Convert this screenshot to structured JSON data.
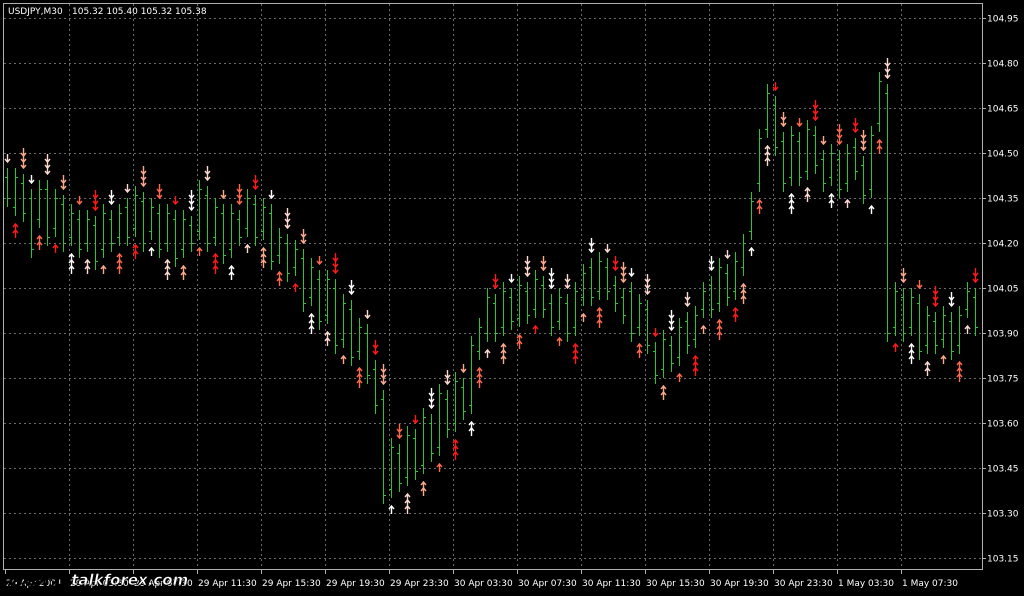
{
  "header": {
    "symbol": "USDJPY,M30",
    "ohlc": "105.32 105.40 105.32 105.38"
  },
  "colors": {
    "background": "#000000",
    "grid": "#6a6a6a",
    "frame": "#b0b0b0",
    "text": "#ffffff",
    "candle": "#2fc42f",
    "arrow_palette": [
      "#ff1a1a",
      "#ff6a4d",
      "#ffa98c",
      "#ffd8d0",
      "#ffffff"
    ]
  },
  "price_axis": {
    "labels": [
      "104.95",
      "104.80",
      "104.65",
      "104.50",
      "104.35",
      "104.20",
      "104.05",
      "103.90",
      "103.75",
      "103.60",
      "103.45",
      "103.30",
      "103.15"
    ],
    "min": 103.15,
    "max": 104.95
  },
  "time_axis": {
    "labels": [
      "29 Apr 2004",
      "29 Apr 03:30",
      "29 Apr 07:30",
      "29 Apr 11:30",
      "29 Apr 15:30",
      "29 Apr 19:30",
      "29 Apr 23:30",
      "30 Apr 03:30",
      "30 Apr 07:30",
      "30 Apr 11:30",
      "30 Apr 15:30",
      "30 Apr 19:30",
      "30 Apr 23:30",
      "1 May 03:30",
      "1 May 07:30"
    ]
  },
  "watermark": {
    "text": "论坛外汇 talkforex.com",
    "icon": "talkforex-logo"
  },
  "chart_data": {
    "type": "ohlc",
    "symbol": "USDJPY",
    "timeframe": "M30",
    "ylim": [
      103.15,
      104.95
    ],
    "grid": true,
    "bars_per_time_label": 8,
    "bars": [
      [
        104.42,
        104.35
      ],
      [
        104.32,
        104.42
      ],
      [
        104.4,
        104.3
      ],
      [
        104.35,
        104.18
      ],
      [
        104.28,
        104.38
      ],
      [
        104.38,
        104.22
      ],
      [
        104.25,
        104.35
      ],
      [
        104.33,
        104.2
      ],
      [
        104.22,
        104.3
      ],
      [
        104.28,
        104.18
      ],
      [
        104.2,
        104.28
      ],
      [
        104.26,
        104.14
      ],
      [
        104.18,
        104.3
      ],
      [
        104.28,
        104.2
      ],
      [
        104.22,
        104.3
      ],
      [
        104.32,
        104.22
      ],
      [
        104.25,
        104.36
      ],
      [
        104.34,
        104.2
      ],
      [
        104.24,
        104.32
      ],
      [
        104.3,
        104.18
      ],
      [
        104.2,
        104.3
      ],
      [
        104.28,
        104.15
      ],
      [
        104.18,
        104.28
      ],
      [
        104.26,
        104.2
      ],
      [
        104.24,
        104.38
      ],
      [
        104.36,
        104.2
      ],
      [
        104.22,
        104.32
      ],
      [
        104.3,
        104.16
      ],
      [
        104.18,
        104.3
      ],
      [
        104.28,
        104.22
      ],
      [
        104.25,
        104.35
      ],
      [
        104.33,
        104.22
      ],
      [
        104.24,
        104.32
      ],
      [
        104.3,
        104.14
      ],
      [
        104.16,
        104.22
      ],
      [
        104.2,
        104.1
      ],
      [
        104.12,
        104.18
      ],
      [
        104.15,
        104.0
      ],
      [
        104.02,
        104.12
      ],
      [
        104.08,
        103.94
      ],
      [
        103.96,
        104.08
      ],
      [
        104.05,
        103.86
      ],
      [
        103.88,
        104.0
      ],
      [
        103.98,
        103.82
      ],
      [
        103.84,
        103.92
      ],
      [
        103.9,
        103.76
      ],
      [
        103.78,
        103.66
      ],
      [
        103.68,
        103.36
      ],
      [
        103.38,
        103.52
      ],
      [
        103.5,
        103.4
      ],
      [
        103.42,
        103.56
      ],
      [
        103.55,
        103.44
      ],
      [
        103.46,
        103.62
      ],
      [
        103.6,
        103.5
      ],
      [
        103.52,
        103.7
      ],
      [
        103.68,
        103.58
      ],
      [
        103.6,
        103.74
      ],
      [
        103.72,
        103.64
      ],
      [
        103.66,
        103.86
      ],
      [
        103.84,
        103.92
      ],
      [
        103.9,
        104.02
      ],
      [
        104.0,
        103.9
      ],
      [
        103.92,
        104.04
      ],
      [
        104.02,
        103.94
      ],
      [
        103.95,
        104.06
      ],
      [
        104.04,
        103.96
      ],
      [
        103.98,
        104.08
      ],
      [
        104.06,
        103.98
      ],
      [
        104.0,
        103.92
      ],
      [
        103.94,
        104.02
      ],
      [
        104.0,
        103.9
      ],
      [
        103.92,
        104.04
      ],
      [
        104.02,
        104.1
      ],
      [
        104.12,
        104.02
      ],
      [
        104.04,
        104.14
      ],
      [
        104.12,
        104.04
      ],
      [
        104.06,
        104.0
      ],
      [
        104.02,
        103.96
      ],
      [
        104.04,
        103.9
      ],
      [
        103.92,
        104.0
      ],
      [
        103.98,
        103.86
      ],
      [
        103.84,
        103.76
      ],
      [
        103.78,
        103.88
      ],
      [
        103.86,
        103.8
      ],
      [
        103.82,
        103.92
      ],
      [
        103.94,
        103.86
      ],
      [
        103.88,
        103.96
      ],
      [
        103.98,
        104.04
      ],
      [
        104.06,
        103.98
      ],
      [
        104.0,
        104.12
      ],
      [
        104.1,
        104.02
      ],
      [
        104.04,
        104.14
      ],
      [
        104.12,
        104.2
      ],
      [
        104.24,
        104.34
      ],
      [
        104.4,
        104.55
      ],
      [
        104.58,
        104.7
      ],
      [
        104.66,
        104.52
      ],
      [
        104.54,
        104.4
      ],
      [
        104.42,
        104.56
      ],
      [
        104.54,
        104.42
      ],
      [
        104.44,
        104.58
      ],
      [
        104.56,
        104.46
      ],
      [
        104.48,
        104.4
      ],
      [
        104.42,
        104.5
      ],
      [
        104.48,
        104.38
      ],
      [
        104.4,
        104.5
      ],
      [
        104.52,
        104.44
      ],
      [
        104.46,
        104.36
      ],
      [
        104.38,
        104.56
      ],
      [
        104.6,
        104.74
      ],
      [
        104.7,
        103.9
      ],
      [
        103.92,
        104.04
      ],
      [
        104.02,
        103.9
      ],
      [
        103.92,
        104.02
      ],
      [
        104.0,
        103.84
      ],
      [
        103.86,
        103.96
      ],
      [
        103.94,
        103.86
      ],
      [
        103.88,
        103.96
      ],
      [
        103.94,
        103.84
      ],
      [
        103.86,
        103.96
      ],
      [
        103.98,
        104.04
      ],
      [
        104.02,
        103.92
      ],
      [
        103.94,
        103.8
      ],
      [
        103.82,
        103.72
      ],
      [
        103.7,
        103.62
      ],
      [
        103.64,
        103.72
      ],
      [
        103.7,
        103.62
      ],
      [
        103.64,
        103.7
      ],
      [
        103.68,
        103.74
      ],
      [
        103.72,
        103.66
      ],
      [
        103.66,
        103.72
      ],
      [
        103.7,
        103.74
      ],
      [
        103.74,
        103.66
      ]
    ]
  }
}
